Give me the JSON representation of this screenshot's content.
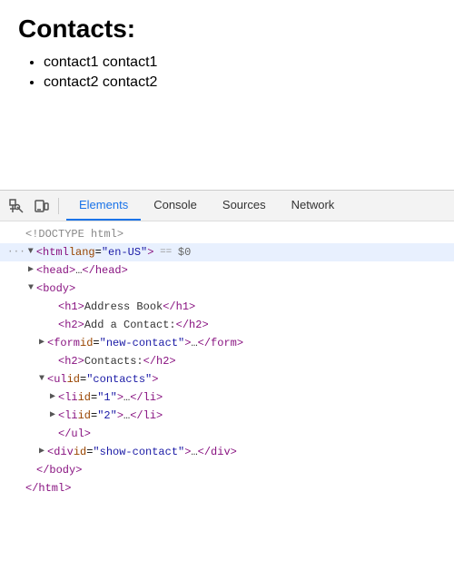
{
  "page": {
    "title": "Contacts:",
    "contacts": [
      {
        "label": "contact1 contact1"
      },
      {
        "label": "contact2 contact2"
      }
    ]
  },
  "devtools": {
    "tabs": [
      {
        "label": "Elements",
        "active": true
      },
      {
        "label": "Console",
        "active": false
      },
      {
        "label": "Sources",
        "active": false
      },
      {
        "label": "Network",
        "active": false
      }
    ],
    "html_tree": [
      {
        "indent": 0,
        "content": "<!DOCTYPE html>",
        "type": "comment"
      },
      {
        "indent": 0,
        "content": "",
        "type": "html-open",
        "dots": true
      },
      {
        "indent": 1,
        "content": "head",
        "type": "collapsed"
      },
      {
        "indent": 1,
        "content": "body",
        "type": "open"
      },
      {
        "indent": 2,
        "content": "h1",
        "type": "inline",
        "text": "Address Book"
      },
      {
        "indent": 2,
        "content": "h2",
        "type": "inline",
        "text": "Add a Contact:"
      },
      {
        "indent": 2,
        "content": "form",
        "type": "collapsed-attr",
        "attr": "id",
        "val": "new-contact"
      },
      {
        "indent": 2,
        "content": "h2",
        "type": "inline",
        "text": "Contacts:"
      },
      {
        "indent": 2,
        "content": "ul",
        "type": "open-attr",
        "attr": "id",
        "val": "contacts"
      },
      {
        "indent": 3,
        "content": "li",
        "type": "collapsed-attr",
        "attr": "id",
        "val": "1"
      },
      {
        "indent": 3,
        "content": "li",
        "type": "collapsed-attr",
        "attr": "id",
        "val": "2"
      },
      {
        "indent": 2,
        "content": "/ul",
        "type": "close"
      },
      {
        "indent": 2,
        "content": "div",
        "type": "collapsed-attr",
        "attr": "id",
        "val": "show-contact"
      },
      {
        "indent": 1,
        "content": "/body",
        "type": "close"
      },
      {
        "indent": 0,
        "content": "/html",
        "type": "close"
      }
    ]
  }
}
